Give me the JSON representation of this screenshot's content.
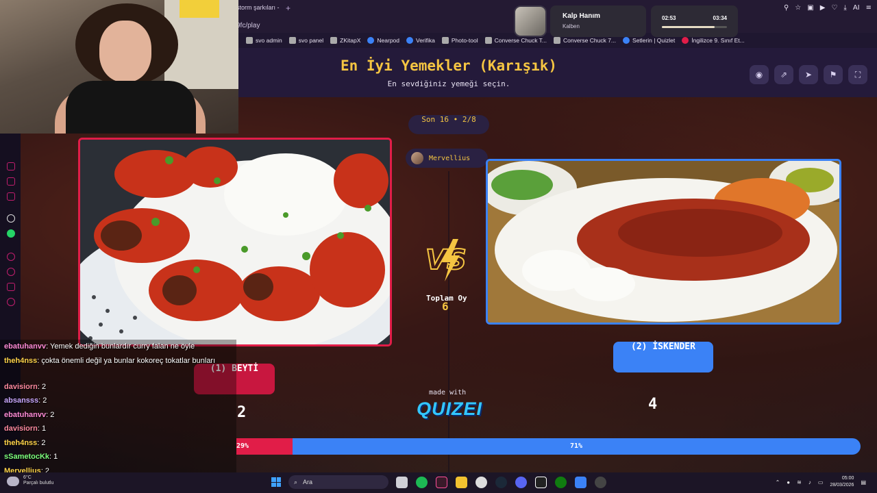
{
  "browser": {
    "tab_title": "storm şarkıları -",
    "new_tab": "+",
    "url": "9fc/play",
    "bookmarks": [
      {
        "label": "svo admin",
        "icon": "gray"
      },
      {
        "label": "svo panel",
        "icon": "gray"
      },
      {
        "label": "ZKitapX",
        "icon": "gray"
      },
      {
        "label": "Nearpod",
        "icon": "blue"
      },
      {
        "label": "Verifika",
        "icon": "blue"
      },
      {
        "label": "Photo-tool",
        "icon": "gray"
      },
      {
        "label": "Converse Chuck T...",
        "icon": "gray"
      },
      {
        "label": "Converse Chuck 7...",
        "icon": "gray"
      },
      {
        "label": "Setlerin | Quizlet",
        "icon": "blue"
      },
      {
        "label": "İngilizce 9. Sınıf Et...",
        "icon": "red"
      }
    ],
    "ai_label": "AI"
  },
  "media": {
    "title": "Kalp Hanım",
    "artist": "Kalben",
    "elapsed": "02:53",
    "duration": "03:34",
    "progress": 0.81
  },
  "quiz": {
    "title": "En İyi Yemekler (Karışık)",
    "subtitle": "En sevdiğiniz yemeği seçin.",
    "round": "Son 16 • 2/8",
    "voter": "Mervellius",
    "vs": "VS",
    "total_label": "Toplam Oy",
    "total_value": "6",
    "left": {
      "label": "(1) BEYTİ",
      "votes": "2",
      "percent_label": "29%",
      "percent": 0.29
    },
    "right": {
      "label": "(2) İSKENDER",
      "votes": "4",
      "percent_label": "71%",
      "percent": 0.71
    },
    "made_with": "made with",
    "brand": "QUIZEI",
    "colors": {
      "left": "#e11d48",
      "right": "#3b82f6",
      "accent": "#f5c542"
    }
  },
  "chat": [
    {
      "user": "ebatuhanvv",
      "color": "#ff8bd6",
      "text": ": Yemek dediğin bunlardır curry falan ne öyle"
    },
    {
      "user": "theh4nss",
      "color": "#ffd34a",
      "text": ": çokta önemli değil ya bunlar kokoreç tokatlar bunları"
    },
    {
      "user": "davisiorn",
      "color": "#ff8aa0",
      "text": ": 2"
    },
    {
      "user": "absansss",
      "color": "#c9a7ff",
      "text": ": 2"
    },
    {
      "user": "ebatuhanvv",
      "color": "#ff8bd6",
      "text": ": 2"
    },
    {
      "user": "davisiorn",
      "color": "#ff8aa0",
      "text": ": 1"
    },
    {
      "user": "theh4nss",
      "color": "#ffd34a",
      "text": ": 2"
    },
    {
      "user": "sSametocKk",
      "color": "#7dff7d",
      "text": ": 1"
    },
    {
      "user": "Mervellius",
      "color": "#ffd34a",
      "text": ": 2"
    }
  ],
  "taskbar": {
    "weather_temp": "6°C",
    "weather_desc": "Parçalı bulutlu",
    "search_placeholder": "Ara",
    "time": "05:00",
    "date": "28/03/2026"
  }
}
